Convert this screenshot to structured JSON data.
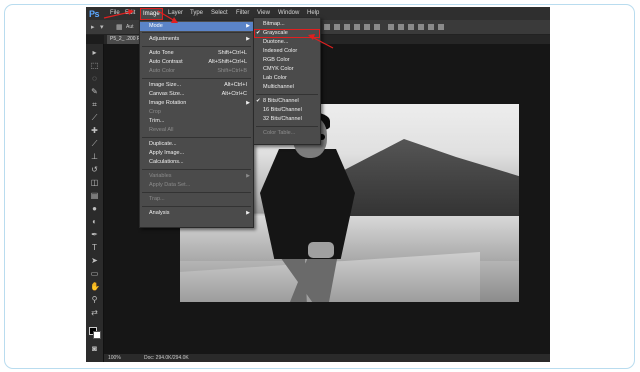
{
  "app": {
    "logo": "Ps",
    "menus": [
      "File",
      "Edit",
      "Image",
      "Layer",
      "Type",
      "Select",
      "Filter",
      "View",
      "Window",
      "Help"
    ],
    "active_menu": "Image"
  },
  "options_bar": {
    "auto_label": "Aut"
  },
  "document_tab": {
    "title": "P5_2_ .200 PS"
  },
  "image_menu": {
    "items": [
      {
        "label": "Mode",
        "shortcut": "",
        "submenu": true,
        "disabled": false,
        "highlight": true
      },
      {
        "label": "Adjustments",
        "shortcut": "",
        "submenu": true,
        "disabled": false
      },
      {
        "label": "Auto Tone",
        "shortcut": "Shift+Ctrl+L",
        "disabled": false
      },
      {
        "label": "Auto Contrast",
        "shortcut": "Alt+Shift+Ctrl+L",
        "disabled": false
      },
      {
        "label": "Auto Color",
        "shortcut": "Shift+Ctrl+B",
        "disabled": true
      },
      {
        "label": "Image Size...",
        "shortcut": "Alt+Ctrl+I",
        "disabled": false
      },
      {
        "label": "Canvas Size...",
        "shortcut": "Alt+Ctrl+C",
        "disabled": false
      },
      {
        "label": "Image Rotation",
        "shortcut": "",
        "submenu": true,
        "disabled": false
      },
      {
        "label": "Crop",
        "shortcut": "",
        "disabled": true
      },
      {
        "label": "Trim...",
        "shortcut": "",
        "disabled": false
      },
      {
        "label": "Reveal All",
        "shortcut": "",
        "disabled": true
      },
      {
        "label": "Duplicate...",
        "shortcut": "",
        "disabled": false
      },
      {
        "label": "Apply Image...",
        "shortcut": "",
        "disabled": false
      },
      {
        "label": "Calculations...",
        "shortcut": "",
        "disabled": false
      },
      {
        "label": "Variables",
        "shortcut": "",
        "submenu": true,
        "disabled": true
      },
      {
        "label": "Apply Data Set...",
        "shortcut": "",
        "disabled": true
      },
      {
        "label": "Trap...",
        "shortcut": "",
        "disabled": true
      },
      {
        "label": "Analysis",
        "shortcut": "",
        "submenu": true,
        "disabled": false
      }
    ]
  },
  "mode_menu": {
    "items": [
      {
        "label": "Bitmap...",
        "checked": false,
        "disabled": false
      },
      {
        "label": "Grayscale",
        "checked": true,
        "disabled": false,
        "boxed": true
      },
      {
        "label": "Duotone...",
        "checked": false,
        "disabled": false
      },
      {
        "label": "Indexed Color",
        "checked": false,
        "disabled": false
      },
      {
        "label": "RGB Color",
        "checked": false,
        "disabled": false
      },
      {
        "label": "CMYK Color",
        "checked": false,
        "disabled": false
      },
      {
        "label": "Lab Color",
        "checked": false,
        "disabled": false
      },
      {
        "label": "Multichannel",
        "checked": false,
        "disabled": false
      },
      {
        "label": "8 Bits/Channel",
        "checked": true,
        "disabled": false
      },
      {
        "label": "16 Bits/Channel",
        "checked": false,
        "disabled": false
      },
      {
        "label": "32 Bits/Channel",
        "checked": false,
        "disabled": false
      },
      {
        "label": "Color Table...",
        "checked": false,
        "disabled": true
      }
    ]
  },
  "status": {
    "zoom": "100%",
    "doc_info": "Doc: 294.0K/294.0K"
  },
  "colors": {
    "annotation": "#e02020",
    "frame": "#b9dcef",
    "highlight": "#5b84c8"
  }
}
